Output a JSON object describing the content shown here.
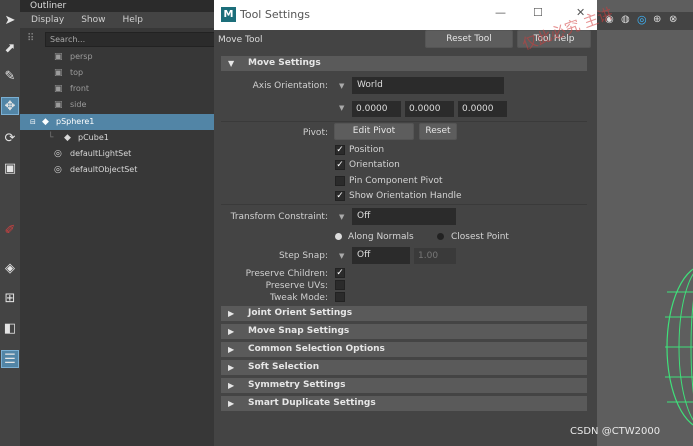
{
  "outliner": {
    "title": "Outliner",
    "menu": [
      "Display",
      "Show",
      "Help"
    ],
    "search_placeholder": "Search...",
    "items": [
      {
        "label": "persp",
        "icon": "camera-icon"
      },
      {
        "label": "top",
        "icon": "camera-icon"
      },
      {
        "label": "front",
        "icon": "camera-icon"
      },
      {
        "label": "side",
        "icon": "camera-icon"
      },
      {
        "label": "pSphere1",
        "icon": "mesh-icon",
        "selected": true
      },
      {
        "label": "pCube1",
        "icon": "mesh-icon"
      },
      {
        "label": "defaultLightSet",
        "icon": "set-icon"
      },
      {
        "label": "defaultObjectSet",
        "icon": "set-icon"
      }
    ]
  },
  "tool_settings": {
    "window_title": "Tool Settings",
    "tool_name": "Move Tool",
    "reset_tool_label": "Reset Tool",
    "tool_help_label": "Tool Help",
    "move_settings": {
      "header": "Move Settings",
      "axis_orientation_label": "Axis Orientation:",
      "axis_orientation_value": "World",
      "axis_values": [
        "0.0000",
        "0.0000",
        "0.0000"
      ],
      "pivot_label": "Pivot:",
      "edit_pivot_label": "Edit Pivot",
      "reset_label": "Reset",
      "pivot_options": [
        {
          "label": "Position",
          "checked": true
        },
        {
          "label": "Orientation",
          "checked": true
        },
        {
          "label": "Pin Component Pivot",
          "checked": false
        },
        {
          "label": "Show Orientation Handle",
          "checked": true
        }
      ],
      "transform_constraint_label": "Transform Constraint:",
      "transform_constraint_value": "Off",
      "along_normals_label": "Along Normals",
      "closest_point_label": "Closest Point",
      "step_snap_label": "Step Snap:",
      "step_snap_value": "Off",
      "step_snap_amount": "1.00",
      "preserve_children_label": "Preserve Children:",
      "preserve_children": true,
      "preserve_uvs_label": "Preserve UVs:",
      "preserve_uvs": false,
      "tweak_mode_label": "Tweak Mode:",
      "tweak_mode": false
    },
    "collapsed_sections": [
      "Joint Orient Settings",
      "Move Snap Settings",
      "Common Selection Options",
      "Soft Selection",
      "Symmetry Settings",
      "Smart Duplicate Settings"
    ]
  },
  "watermark": "CSDN @CTW2000",
  "overlay_text": "仅此必究 主讲"
}
